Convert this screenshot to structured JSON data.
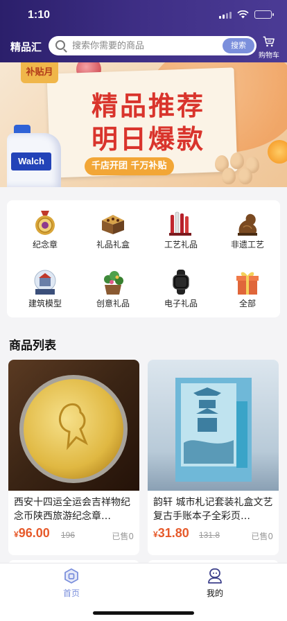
{
  "status": {
    "time": "1:10"
  },
  "header": {
    "brand": "精品汇",
    "search_placeholder": "搜索你需要的商品",
    "search_button": "搜索",
    "cart_label": "购物车"
  },
  "banner": {
    "tag": "补贴月",
    "line1": "精品推荐",
    "line2": "明日爆款",
    "subtitle": "千店开团 千万补贴",
    "product_brand": "Walch"
  },
  "categories": [
    {
      "label": "纪念章",
      "icon": "medal-icon"
    },
    {
      "label": "礼品礼盒",
      "icon": "gift-box-icon"
    },
    {
      "label": "工艺礼品",
      "icon": "craft-pens-icon"
    },
    {
      "label": "非遗工艺",
      "icon": "carving-icon"
    },
    {
      "label": "建筑模型",
      "icon": "snow-globe-icon"
    },
    {
      "label": "创意礼品",
      "icon": "plant-pot-icon"
    },
    {
      "label": "电子礼品",
      "icon": "smartwatch-icon"
    },
    {
      "label": "全部",
      "icon": "present-icon"
    }
  ],
  "section_title": "商品列表",
  "products": [
    {
      "title": "西安十四运全运会吉祥物纪念币陕西旅游纪念章…",
      "currency": "¥",
      "price": "96.00",
      "original_price": "196",
      "sold": "已售0"
    },
    {
      "title": "韵轩 城市札记套装礼盒文艺复古手账本子全彩页…",
      "currency": "¥",
      "price": "31.80",
      "original_price": "131.8",
      "sold": "已售0"
    }
  ],
  "tabs": [
    {
      "label": "首页",
      "icon": "home-icon",
      "active": true
    },
    {
      "label": "我的",
      "icon": "profile-icon",
      "active": false
    }
  ],
  "colors": {
    "accent": "#7b8fdc",
    "price": "#e65a2b",
    "header": "#3f2f86"
  }
}
